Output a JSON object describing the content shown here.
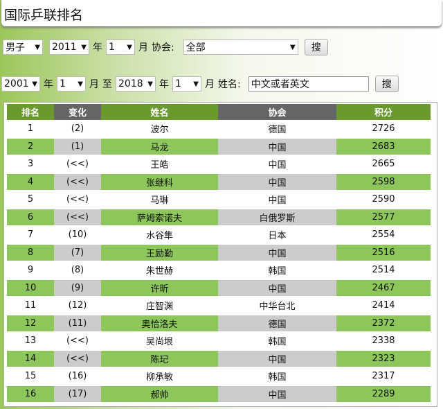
{
  "title": "国际乒联排名",
  "filter1": {
    "gender": "男子",
    "year": "2011",
    "year_unit": "年",
    "month": "1",
    "month_unit": "月",
    "assoc_label": "协会:",
    "assoc": "全部",
    "search": "搜"
  },
  "filter2": {
    "from_year": "2001",
    "year_unit": "年",
    "from_month": "1",
    "month_unit": "月",
    "to": "至",
    "to_year": "2018",
    "to_month": "1",
    "name_label": "姓名:",
    "name_placeholder": "中文或者英文",
    "search": "搜"
  },
  "table": {
    "headers": [
      "排名",
      "变化",
      "姓名",
      "协会",
      "积分"
    ],
    "rows": [
      [
        "1",
        "(2)",
        "波尔",
        "德国",
        "2726"
      ],
      [
        "2",
        "(1)",
        "马龙",
        "中国",
        "2683"
      ],
      [
        "3",
        "(<<)",
        "王皓",
        "中国",
        "2665"
      ],
      [
        "4",
        "(<<)",
        "张继科",
        "中国",
        "2598"
      ],
      [
        "5",
        "(<<)",
        "马琳",
        "中国",
        "2590"
      ],
      [
        "6",
        "(<<)",
        "萨姆索诺夫",
        "白俄罗斯",
        "2577"
      ],
      [
        "7",
        "(10)",
        "水谷隼",
        "日本",
        "2554"
      ],
      [
        "8",
        "(7)",
        "王励勤",
        "中国",
        "2516"
      ],
      [
        "9",
        "(8)",
        "朱世赫",
        "韩国",
        "2514"
      ],
      [
        "10",
        "(9)",
        "许昕",
        "中国",
        "2467"
      ],
      [
        "11",
        "(12)",
        "庄智渊",
        "中华台北",
        "2414"
      ],
      [
        "12",
        "(11)",
        "奥恰洛夫",
        "德国",
        "2372"
      ],
      [
        "13",
        "(<<)",
        "吴尚垠",
        "韩国",
        "2338"
      ],
      [
        "14",
        "(<<)",
        "陈玘",
        "中国",
        "2323"
      ],
      [
        "15",
        "(16)",
        "柳承敏",
        "韩国",
        "2317"
      ],
      [
        "16",
        "(17)",
        "郝帅",
        "中国",
        "2289"
      ]
    ]
  }
}
